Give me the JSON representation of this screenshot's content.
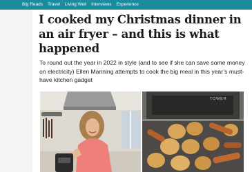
{
  "nav": {
    "items": [
      {
        "label": "Big Reads"
      },
      {
        "label": "Travel"
      },
      {
        "label": "Living Well"
      },
      {
        "label": "Interviews"
      },
      {
        "label": "Experience"
      }
    ]
  },
  "article": {
    "headline": "I cooked my Christmas dinner in an air fryer – and this is what happened",
    "standfirst": "To round out the year in 2022 in style (and to see if she can save some money on electricity) Ellen Manning attempts to cook the big meal in this year’s must-have kitchen gadget"
  },
  "photos": {
    "right_brand": "TOWER"
  },
  "colors": {
    "nav_background": "#1a8c9e",
    "headline": "#1b1b1b",
    "text": "#222222"
  }
}
